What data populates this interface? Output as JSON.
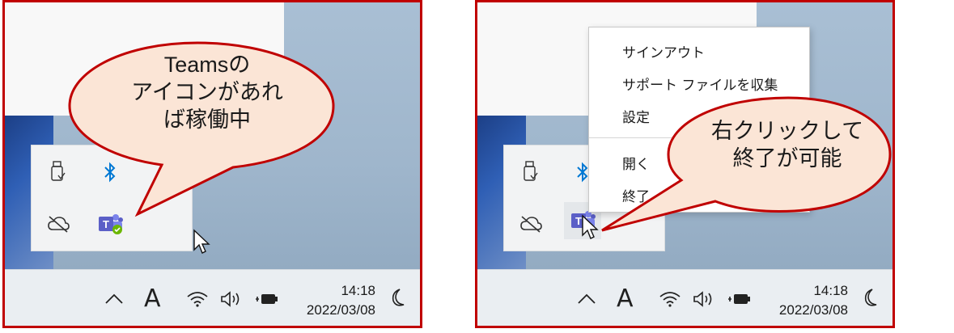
{
  "left_panel": {
    "callout_lines": [
      "Teamsの",
      "アイコンがあれ",
      "ば稼働中"
    ],
    "taskbar": {
      "time": "14:18",
      "date": "2022/03/08",
      "ime": "A",
      "chevron": "^"
    }
  },
  "right_panel": {
    "context_menu": {
      "items": [
        "サインアウト",
        "サポート ファイルを収集",
        "設定",
        "開く",
        "終了"
      ]
    },
    "callout_lines": [
      "右クリックして",
      "終了が可能"
    ],
    "taskbar": {
      "time": "14:18",
      "date": "2022/03/08",
      "ime": "A",
      "chevron": "^"
    }
  },
  "colors": {
    "frame": "#c00000",
    "callout_fill": "#fbe5d6",
    "callout_stroke": "#c00000",
    "teams": "#5b5fc7",
    "bluetooth": "#0078d4"
  },
  "icons": [
    "usb-drive-icon",
    "bluetooth-icon",
    "cloud-offline-icon",
    "teams-icon",
    "wifi-icon",
    "speaker-icon",
    "battery-icon",
    "moon-icon",
    "mouse-cursor-icon"
  ]
}
